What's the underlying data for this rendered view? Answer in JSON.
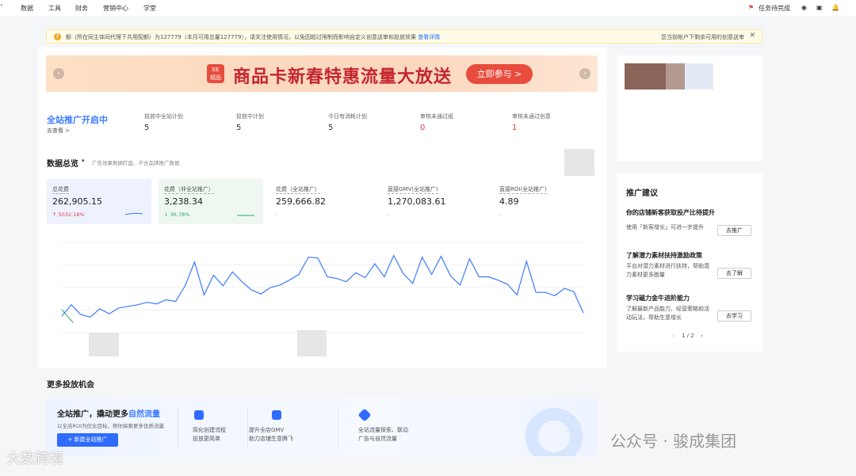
{
  "topnav": {
    "items": [
      "数据",
      "工具",
      "财务",
      "营销中心",
      "学堂"
    ],
    "task_label": "任务待完成"
  },
  "notice": {
    "text": "额（所在同主体同代理下共用配额）为127779（本月可用总量127779），请关注使用情况，以免因超过限制而影响自定义创意送审和投放效果",
    "link": "查看详情",
    "right_text": "您当前帐户下剩余可用的创意送审"
  },
  "banner": {
    "logo_text": "EE\n超品",
    "title": "商品卡新春特惠流量大放送",
    "cta": "立即参与 >"
  },
  "promo_status": {
    "title": "全站推广开启中",
    "link": "去查看 >",
    "stats": [
      {
        "label": "投放中全站计划",
        "value": "5"
      },
      {
        "label": "投放中计划",
        "value": "5"
      },
      {
        "label": "今日有消耗计划",
        "value": "5"
      },
      {
        "label": "审核未通过组",
        "value": "0"
      },
      {
        "label": "审核未通过创意",
        "value": "1"
      }
    ]
  },
  "overview": {
    "title": "数据总览",
    "note": "广告效果数据盯盘、不含品牌推广数据",
    "metrics": [
      {
        "label": "总花费",
        "value": "262,905.15",
        "delta": "↑ 5032.18%",
        "delta_color": "#e23c3c"
      },
      {
        "label": "花费（非全站推广）",
        "value": "3,238.34",
        "delta": "↓ 36.78%",
        "delta_color": "#2aa862"
      },
      {
        "label": "花费（全站推广）",
        "value": "259,666.82",
        "delta": "-",
        "delta_color": "#999999"
      },
      {
        "label": "直接GMV(全站推广)",
        "value": "1,270,083.61",
        "delta": "-",
        "delta_color": "#999999"
      },
      {
        "label": "直接ROI(全站推广)",
        "value": "4.89",
        "delta": "-",
        "delta_color": "#999999"
      }
    ]
  },
  "chart_data": {
    "type": "line",
    "series": [
      {
        "values": [
          60,
          74,
          62,
          59,
          69,
          63,
          70,
          72,
          74,
          77,
          75,
          80,
          78,
          97,
          126,
          86,
          110,
          97,
          114,
          102,
          92,
          87,
          95,
          98,
          104,
          111,
          132,
          131,
          108,
          106,
          102,
          113,
          107,
          124,
          108,
          134,
          112,
          100,
          132,
          111,
          133,
          109,
          98,
          130,
          108,
          108,
          104,
          99,
          86,
          127,
          89,
          89,
          85,
          94,
          90,
          64
        ]
      }
    ],
    "green_series": [
      {
        "values": [
          68,
          60,
          52
        ]
      }
    ],
    "ylim": [
      40,
      150
    ]
  },
  "sidebar": {
    "advice_title": "推广建议",
    "tips": [
      {
        "title": "你的店铺新客获取投产比待提升",
        "desc": "使用「新客增长」可进一步提升",
        "button": "去推广"
      },
      {
        "title": "了解潜力素材扶持激励政策",
        "desc": "平台对潜力素材进行扶持，帮助潜力素材更多跑量",
        "button": "去了解"
      },
      {
        "title": "学习磁力金牛进阶能力",
        "desc": "了解最新产品能力、经营策略和活动玩法，帮助生意增长",
        "button": "去学习"
      }
    ],
    "pager": "1 / 2"
  },
  "more": {
    "section_title": "更多投放机会",
    "card_title_a": "全站推广，撬动更多",
    "card_title_b": "自然流量",
    "card_desc": "以全店ROI为优化目标，帮你探索更多优质流量",
    "cta": "+ 新建全站推广",
    "features": [
      {
        "line1": "简化创建流程",
        "line2": "投放更简单"
      },
      {
        "line1": "提升全店GMV",
        "line2": "助力店铺生意腾飞"
      },
      {
        "line1": "全站流量探索、联动",
        "line2": "广告与自然流量"
      }
    ]
  },
  "watermarks": {
    "left": "大数跨境",
    "right": "公众号 · 骏成集团"
  }
}
